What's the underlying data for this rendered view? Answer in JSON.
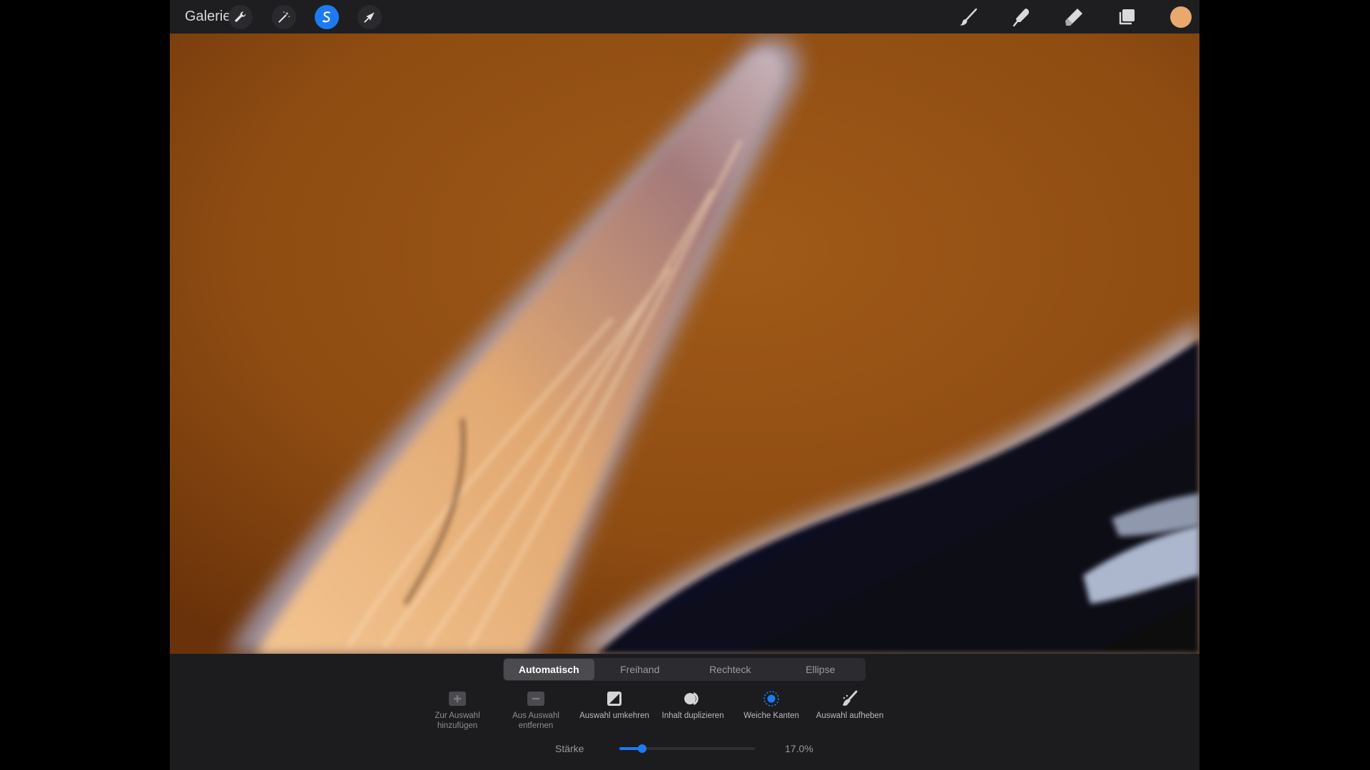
{
  "topbar": {
    "gallery_label": "Galerie",
    "left_tools": [
      {
        "name": "actions",
        "icon": "wrench-icon",
        "active": false
      },
      {
        "name": "adjustments",
        "icon": "magic-wand-icon",
        "active": false
      },
      {
        "name": "selection",
        "icon": "selection-s-icon",
        "active": true
      },
      {
        "name": "transform",
        "icon": "arrow-cursor-icon",
        "active": false
      }
    ],
    "right_tools": [
      {
        "name": "brush",
        "icon": "brush-icon"
      },
      {
        "name": "smudge",
        "icon": "smudge-finger-icon"
      },
      {
        "name": "eraser",
        "icon": "eraser-icon"
      },
      {
        "name": "layers",
        "icon": "layers-icon"
      }
    ],
    "color": "#e8a86e"
  },
  "panel": {
    "modes": [
      "Automatisch",
      "Freihand",
      "Rechteck",
      "Ellipse"
    ],
    "active_mode": "Automatisch",
    "tools": [
      {
        "label": "Zur Auswahl hinzufügen",
        "icon": "plus-square-icon"
      },
      {
        "label": "Aus Auswahl entfernen",
        "icon": "minus-square-icon"
      },
      {
        "label": "Auswahl umkehren",
        "icon": "invert-icon"
      },
      {
        "label": "Inhalt duplizieren",
        "icon": "duplicate-circles-icon"
      },
      {
        "label": "Weiche Kanten",
        "icon": "feather-dot-icon"
      },
      {
        "label": "Auswahl aufheben",
        "icon": "clear-brush-icon"
      }
    ],
    "strength_label": "Stärke",
    "strength_value": "17.0%",
    "strength_fraction": 0.17
  },
  "colors": {
    "accent": "#1d7af3",
    "toolbar": "#1e1e21",
    "panel": "#1c1c1e"
  }
}
